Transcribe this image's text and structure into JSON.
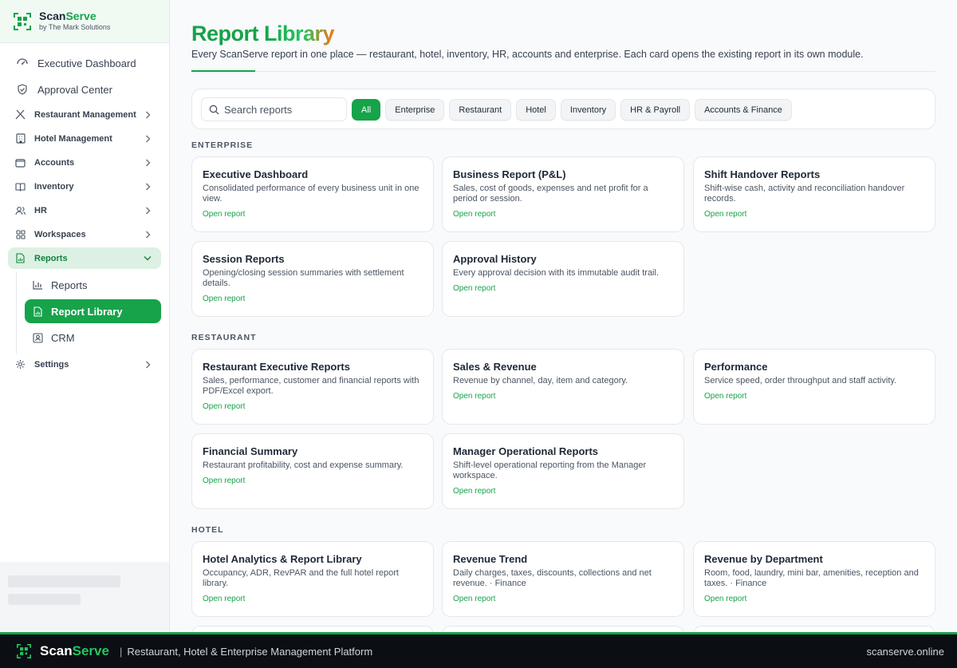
{
  "brand": {
    "name_a": "Scan",
    "name_b": "Serve",
    "sub": "by The Mark Solutions"
  },
  "sidebar": {
    "top_items": [
      {
        "label": "Executive Dashboard"
      },
      {
        "label": "Approval Center"
      }
    ],
    "groups": [
      {
        "label": "Restaurant Management"
      },
      {
        "label": "Hotel Management"
      },
      {
        "label": "Accounts"
      },
      {
        "label": "Inventory"
      },
      {
        "label": "HR"
      },
      {
        "label": "Workspaces"
      },
      {
        "label": "Reports"
      },
      {
        "label": "Settings"
      }
    ],
    "reports_sub": [
      {
        "label": "Reports"
      },
      {
        "label": "Report Library"
      },
      {
        "label": "CRM"
      }
    ]
  },
  "header": {
    "title_a": "Report ",
    "title_b": "Library",
    "subtitle": "Every ScanServe report in one place — restaurant, hotel, inventory, HR, accounts and enterprise. Each card opens the existing report in its own module."
  },
  "filters": {
    "search_placeholder": "Search reports",
    "chips": [
      "All",
      "Enterprise",
      "Restaurant",
      "Hotel",
      "Inventory",
      "HR & Payroll",
      "Accounts & Finance"
    ]
  },
  "sections": [
    {
      "label": "ENTERPRISE",
      "cards": [
        {
          "title": "Executive Dashboard",
          "desc": "Consolidated performance of every business unit in one view.",
          "link": "Open report"
        },
        {
          "title": "Business Report (P&L)",
          "desc": "Sales, cost of goods, expenses and net profit for a period or session.",
          "link": "Open report"
        },
        {
          "title": "Shift Handover Reports",
          "desc": "Shift-wise cash, activity and reconciliation handover records.",
          "link": "Open report"
        },
        {
          "title": "Session Reports",
          "desc": "Opening/closing session summaries with settlement details.",
          "link": "Open report"
        },
        {
          "title": "Approval History",
          "desc": "Every approval decision with its immutable audit trail.",
          "link": "Open report"
        }
      ]
    },
    {
      "label": "RESTAURANT",
      "cards": [
        {
          "title": "Restaurant Executive Reports",
          "desc": "Sales, performance, customer and financial reports with PDF/Excel export.",
          "link": "Open report"
        },
        {
          "title": "Sales & Revenue",
          "desc": "Revenue by channel, day, item and category.",
          "link": "Open report"
        },
        {
          "title": "Performance",
          "desc": "Service speed, order throughput and staff activity.",
          "link": "Open report"
        },
        {
          "title": "Financial Summary",
          "desc": "Restaurant profitability, cost and expense summary.",
          "link": "Open report"
        },
        {
          "title": "Manager Operational Reports",
          "desc": "Shift-level operational reporting from the Manager workspace.",
          "link": "Open report"
        }
      ]
    },
    {
      "label": "HOTEL",
      "cards": [
        {
          "title": "Hotel Analytics & Report Library",
          "desc": "Occupancy, ADR, RevPAR and the full hotel report library.",
          "link": "Open report"
        },
        {
          "title": "Revenue Trend",
          "desc": "Daily charges, taxes, discounts, collections and net revenue. · Finance",
          "link": "Open report"
        },
        {
          "title": "Revenue by Department",
          "desc": "Room, food, laundry, mini bar, amenities, reception and taxes. · Finance",
          "link": "Open report"
        }
      ]
    }
  ],
  "footer": {
    "brand_a": "Scan",
    "brand_b": "Serve",
    "sep": "|",
    "tagline": "Restaurant, Hotel & Enterprise Management Platform",
    "url": "scanserve.online"
  },
  "colors": {
    "accent": "#16a34a",
    "accent_light": "#dcf1e3",
    "footer_bg": "#0b0f14"
  }
}
